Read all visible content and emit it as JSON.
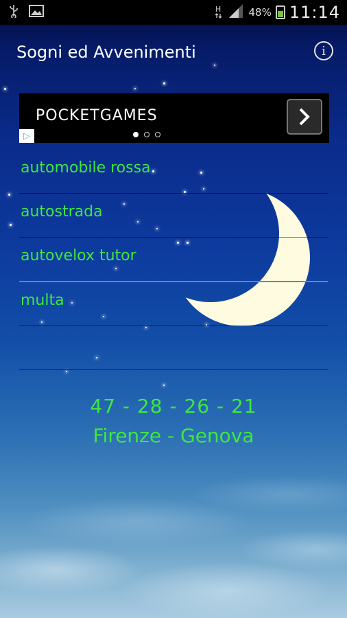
{
  "status_bar": {
    "battery_percent": "48%",
    "time": "11:14",
    "icons": [
      "usb-icon",
      "image-icon",
      "hsdpa-icon",
      "signal-icon",
      "battery-icon"
    ]
  },
  "app_bar": {
    "title": "Sogni ed Avvenimenti",
    "info_icon": "info-icon"
  },
  "ad": {
    "title": "POCKETGAMES",
    "arrow": "›",
    "choices_icon": "▷",
    "pager_active": 0,
    "pager_count": 3
  },
  "list": {
    "items": [
      {
        "label": "automobile rossa"
      },
      {
        "label": "autostrada"
      },
      {
        "label": "autovelox tutor"
      },
      {
        "label": "multa"
      },
      {
        "label": ""
      }
    ],
    "selected_index": 2
  },
  "result": {
    "numbers": "47 - 28 - 26 - 21",
    "cities": "Firenze - Genova"
  },
  "colors": {
    "accent_text": "#3ee83e",
    "divider_selected": "#27a8a0"
  }
}
